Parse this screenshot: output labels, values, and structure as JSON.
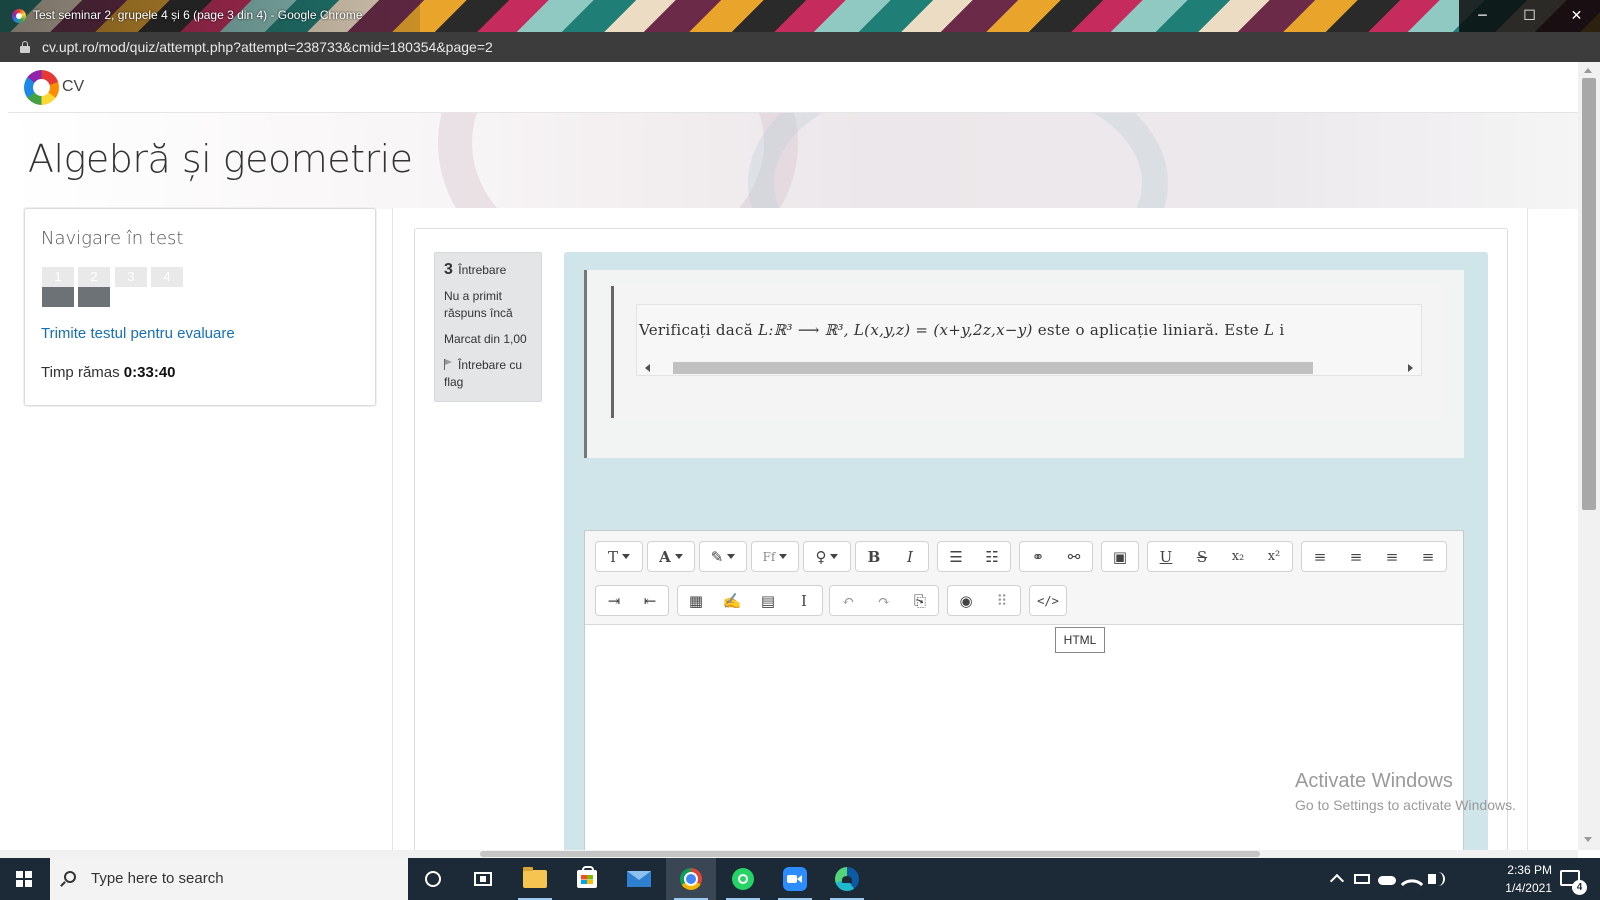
{
  "window": {
    "title": "Test seminar 2, grupele 4 și 6 (page 3 din 4) - Google Chrome",
    "controls": [
      "─",
      "☐",
      "✕"
    ]
  },
  "address_bar": {
    "url": "cv.upt.ro/mod/quiz/attempt.php?attempt=238733&cmid=180354&page=2"
  },
  "site": {
    "brand": "CV",
    "course_title": "Algebră și geometrie"
  },
  "quiz_nav": {
    "title": "Navigare în test",
    "questions": [
      {
        "number": "1",
        "state": "answered"
      },
      {
        "number": "2",
        "state": "answered"
      },
      {
        "number": "3",
        "state": "empty"
      },
      {
        "number": "4",
        "state": "empty"
      }
    ],
    "finish_link": "Trimite testul pentru evaluare",
    "time_label": "Timp rămas",
    "time_value": "0:33:40"
  },
  "question": {
    "number": "3",
    "label": "Întrebare",
    "status": "Nu a primit răspuns încă",
    "marks": "Marcat din 1,00",
    "flag_label": "Întrebare cu flag",
    "text_prefix": "Verificați dacă",
    "text_math1": "L:ℝ³ ⟶ ℝ³,",
    "text_math2": "L(x,y,z) = (x+y,2z,x−y)",
    "text_middle": "este o aplicație liniară. Este",
    "text_math3": "L",
    "text_tail": "i"
  },
  "editor": {
    "toolbar_row1": [
      {
        "icon": "paragraph-style-icon",
        "glyph": "T",
        "dropdown": true
      },
      {
        "icon": "font-color-icon",
        "glyph": "A",
        "dropdown": true
      },
      {
        "icon": "background-color-icon",
        "glyph": "✎",
        "dropdown": true
      },
      {
        "icon": "font-family-icon",
        "glyph": "Ff",
        "dropdown": true
      },
      {
        "icon": "lightbulb-icon",
        "glyph": "♀",
        "dropdown": true
      },
      {
        "icon": "bold-icon",
        "glyph": "B"
      },
      {
        "icon": "italic-icon",
        "glyph": "I"
      },
      {
        "icon": "unordered-list-icon",
        "glyph": "☰"
      },
      {
        "icon": "ordered-list-icon",
        "glyph": "☷"
      },
      {
        "icon": "link-icon",
        "glyph": "⚭"
      },
      {
        "icon": "unlink-icon",
        "glyph": "⚯"
      },
      {
        "icon": "image-icon",
        "glyph": "▣"
      },
      {
        "icon": "underline-icon",
        "glyph": "U"
      },
      {
        "icon": "strikethrough-icon",
        "glyph": "S"
      },
      {
        "icon": "subscript-icon",
        "glyph": "x₂"
      },
      {
        "icon": "superscript-icon",
        "glyph": "x²"
      },
      {
        "icon": "align-left-icon",
        "glyph": "≡"
      },
      {
        "icon": "align-center-icon",
        "glyph": "≡"
      },
      {
        "icon": "align-right-icon",
        "glyph": "≡"
      },
      {
        "icon": "align-justify-icon",
        "glyph": "≡"
      }
    ],
    "toolbar_row2": [
      {
        "icon": "indent-icon",
        "glyph": "⇥"
      },
      {
        "icon": "outdent-icon",
        "glyph": "⇤"
      },
      {
        "icon": "equation-icon",
        "glyph": "▦"
      },
      {
        "icon": "edit-icon",
        "glyph": "✍"
      },
      {
        "icon": "table-icon",
        "glyph": "▤"
      },
      {
        "icon": "cursor-icon",
        "glyph": "I"
      },
      {
        "icon": "undo-icon",
        "glyph": "↶"
      },
      {
        "icon": "redo-icon",
        "glyph": "↷"
      },
      {
        "icon": "paste-icon",
        "glyph": "⎘"
      },
      {
        "icon": "accessibility-icon",
        "glyph": "◉"
      },
      {
        "icon": "screenreader-icon",
        "glyph": "⠿"
      },
      {
        "icon": "html-source-icon",
        "glyph": "</>"
      }
    ],
    "tooltip": "HTML"
  },
  "watermark": {
    "line1": "Activate Windows",
    "line2": "Go to Settings to activate Windows."
  },
  "taskbar": {
    "search_placeholder": "Type here to search",
    "time": "2:36 PM",
    "date": "1/4/2021",
    "notification_count": "4"
  }
}
